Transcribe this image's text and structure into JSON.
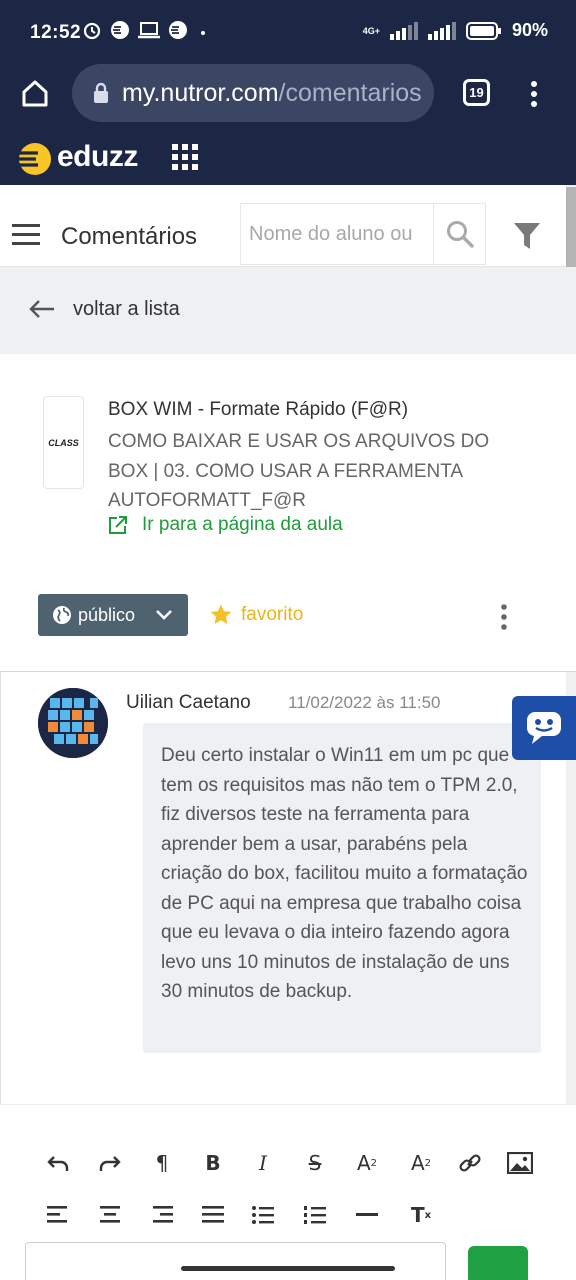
{
  "status_bar": {
    "time": "12:52",
    "network": "4G+",
    "battery": "90%"
  },
  "browser": {
    "url_host": "my.nutror.com",
    "url_path": "/comentarios",
    "tab_count": "19"
  },
  "brand": {
    "logo_text": "eduzz"
  },
  "header": {
    "title": "Comentários",
    "search_placeholder": "Nome do aluno ou"
  },
  "back": {
    "label": "voltar a lista"
  },
  "lesson": {
    "thumb_label": "CLASS",
    "course": "BOX WIM - Formate Rápido (F@R)",
    "title": "COMO BAIXAR E USAR OS ARQUIVOS DO BOX | 03. COMO USAR A FERRAMENTA AUTOFORMATT_F@R",
    "link_label": "Ir para a página da aula",
    "visibility": "público",
    "favorite": "favorito"
  },
  "comment": {
    "author": "Uilian Caetano",
    "date": "11/02/2022 às 11:50",
    "text": "Deu certo instalar o Win11 em um pc que tem os requisitos mas não tem o TPM 2.0, fiz diversos teste na ferramenta para aprender bem a usar, parabéns pela criação do box, facilitou muito a formatação de PC aqui na empresa que trabalho coisa que eu levava o dia inteiro fazendo agora levo uns 10 minutos de instalação de uns 30 minutos de backup."
  },
  "editor": {
    "tools_row1": [
      "undo-icon",
      "redo-icon",
      "paragraph-icon",
      "bold-icon",
      "italic-icon",
      "strikethrough-icon",
      "superscript-icon",
      "subscript-icon",
      "link-icon",
      "image-icon"
    ],
    "tools_row2": [
      "align-left-icon",
      "align-center-icon",
      "align-right-icon",
      "align-justify-icon",
      "bullet-list-icon",
      "numbered-list-icon",
      "horizontal-rule-icon",
      "clear-format-icon"
    ]
  },
  "colors": {
    "header_dark": "#1c2745",
    "accent_green": "#1f9d3a",
    "favorite_gold": "#e8b51b",
    "visibility_button": "#4f6270",
    "chat_blue": "#1e4fa8"
  }
}
